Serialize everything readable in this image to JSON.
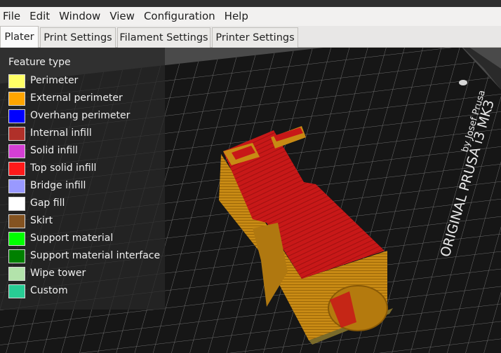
{
  "menu": [
    "File",
    "Edit",
    "Window",
    "View",
    "Configuration",
    "Help"
  ],
  "tabs": [
    "Plater",
    "Print Settings",
    "Filament Settings",
    "Printer Settings"
  ],
  "active_tab": "Plater",
  "bed_text": {
    "brand": "ORIGINAL PRUSA i3 MK3",
    "by": "by Josef Prusa"
  },
  "legend": {
    "title": "Feature type",
    "items": [
      {
        "label": "Perimeter",
        "color": "#ffff66"
      },
      {
        "label": "External perimeter",
        "color": "#ffa500"
      },
      {
        "label": "Overhang perimeter",
        "color": "#0000ff"
      },
      {
        "label": "Internal infill",
        "color": "#b03029"
      },
      {
        "label": "Solid infill",
        "color": "#d43fd4"
      },
      {
        "label": "Top solid infill",
        "color": "#ff1a1a"
      },
      {
        "label": "Bridge infill",
        "color": "#9999ff"
      },
      {
        "label": "Gap fill",
        "color": "#ffffff"
      },
      {
        "label": "Skirt",
        "color": "#845321"
      },
      {
        "label": "Support material",
        "color": "#00ff00"
      },
      {
        "label": "Support material interface",
        "color": "#008000"
      },
      {
        "label": "Wipe tower",
        "color": "#b3e3ab"
      },
      {
        "label": "Custom",
        "color": "#28cc94"
      }
    ]
  },
  "colors": {
    "bed": "#161616",
    "grid": "#7a7a7a",
    "part_side": "#c88a14",
    "part_top": "#c81818"
  }
}
